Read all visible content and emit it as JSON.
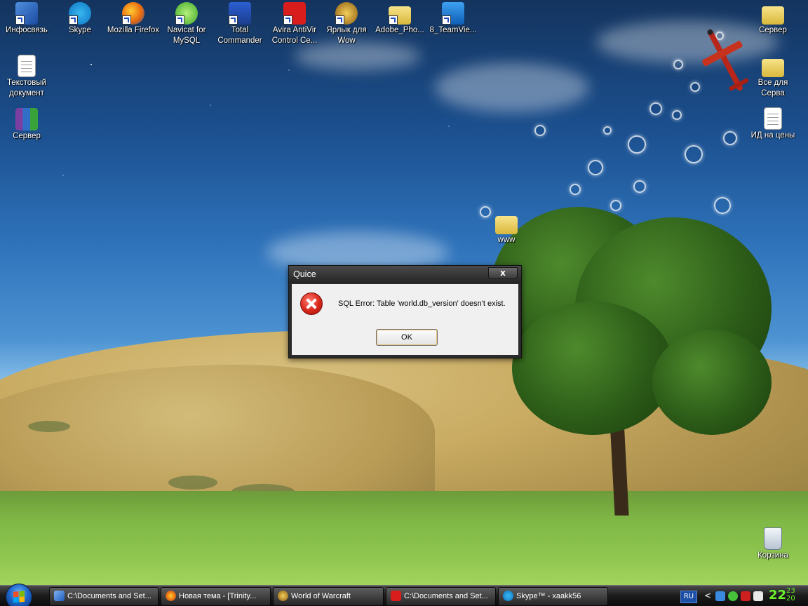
{
  "desktop": {
    "icons_left": [
      {
        "label": "Инфосвязь",
        "icon": "network-shortcut-icon"
      },
      {
        "label": "Skype",
        "icon": "skype-icon"
      },
      {
        "label": "Mozilla Firefox",
        "icon": "firefox-icon"
      },
      {
        "label": "Navicat for MySQL",
        "icon": "navicat-icon"
      },
      {
        "label": "Total Commander",
        "icon": "floppy-disk-icon"
      },
      {
        "label": "Avira AntiVir Control Ce...",
        "icon": "avira-icon"
      },
      {
        "label": "Ярлык для Wow",
        "icon": "wow-icon"
      },
      {
        "label": "Adobe_Pho...",
        "icon": "folder-icon"
      },
      {
        "label": "8_TeamVie...",
        "icon": "teamviewer-icon"
      },
      {
        "label": "Текстовый документ",
        "icon": "text-document-icon"
      },
      {
        "label": "Сервер",
        "icon": "winrar-icon"
      }
    ],
    "icons_right": [
      {
        "label": "Сервер",
        "icon": "folder-icon"
      },
      {
        "label": "Все для Серва",
        "icon": "folder-icon"
      },
      {
        "label": "ИД на цены",
        "icon": "text-document-icon"
      },
      {
        "label": "Корзина",
        "icon": "recycle-bin-icon"
      }
    ],
    "middle_folder": {
      "label": "www",
      "icon": "folder-icon"
    }
  },
  "dialog": {
    "title": "Quice",
    "close_label": "x",
    "message": "SQL Error: Table 'world.db_version' doesn't exist.",
    "ok_label": "OK"
  },
  "taskbar": {
    "buttons": [
      {
        "label": "C:\\Documents and Set...",
        "icon": "explorer-icon"
      },
      {
        "label": "Новая тема - [Trinity...",
        "icon": "firefox-icon"
      },
      {
        "label": "World of Warcraft",
        "icon": "wow-icon"
      },
      {
        "label": "C:\\Documents and Set...",
        "icon": "avira-icon"
      },
      {
        "label": "Skype™ - xaakk56",
        "icon": "skype-icon"
      }
    ],
    "language": "RU",
    "clock_hour": "22",
    "clock_minutes": "23",
    "clock_seconds": "20"
  },
  "colors": {
    "dialog_frame": "#2b2b2b",
    "dialog_body": "#f0f0f0",
    "clock": "#6cf22a",
    "error_red": "#d8271b"
  }
}
